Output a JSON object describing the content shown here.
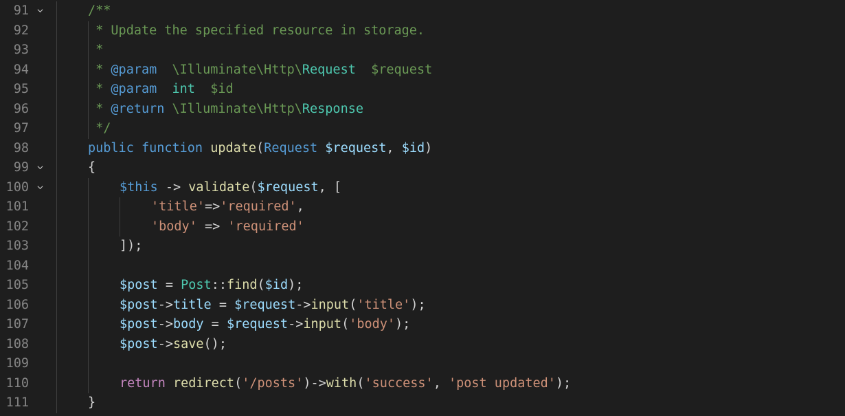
{
  "editor": {
    "lines": [
      {
        "number": "91",
        "fold": true,
        "indent": 1,
        "tokens": [
          {
            "t": "/**",
            "c": "c-com"
          }
        ]
      },
      {
        "number": "92",
        "fold": false,
        "indent": 1,
        "tokens": [
          {
            "t": " * Update the specified resource in storage.",
            "c": "c-com"
          }
        ]
      },
      {
        "number": "93",
        "fold": false,
        "indent": 1,
        "tokens": [
          {
            "t": " *",
            "c": "c-com"
          }
        ]
      },
      {
        "number": "94",
        "fold": false,
        "indent": 1,
        "tokens": [
          {
            "t": " * ",
            "c": "c-com"
          },
          {
            "t": "@param",
            "c": "c-tag"
          },
          {
            "t": "  \\Illuminate\\Http\\",
            "c": "c-com"
          },
          {
            "t": "Request",
            "c": "c-cls"
          },
          {
            "t": "  $request",
            "c": "c-com"
          }
        ]
      },
      {
        "number": "95",
        "fold": false,
        "indent": 1,
        "tokens": [
          {
            "t": " * ",
            "c": "c-com"
          },
          {
            "t": "@param",
            "c": "c-tag"
          },
          {
            "t": "  ",
            "c": "c-com"
          },
          {
            "t": "int",
            "c": "c-cls"
          },
          {
            "t": "  $id",
            "c": "c-com"
          }
        ]
      },
      {
        "number": "96",
        "fold": false,
        "indent": 1,
        "tokens": [
          {
            "t": " * ",
            "c": "c-com"
          },
          {
            "t": "@return",
            "c": "c-tag"
          },
          {
            "t": " \\Illuminate\\Http\\",
            "c": "c-com"
          },
          {
            "t": "Response",
            "c": "c-cls"
          }
        ]
      },
      {
        "number": "97",
        "fold": false,
        "indent": 1,
        "tokens": [
          {
            "t": " */",
            "c": "c-com"
          }
        ]
      },
      {
        "number": "98",
        "fold": false,
        "indent": 1,
        "tokens": [
          {
            "t": "public",
            "c": "c-kw"
          },
          {
            "t": " ",
            "c": "c-pun"
          },
          {
            "t": "function",
            "c": "c-kw"
          },
          {
            "t": " ",
            "c": "c-pun"
          },
          {
            "t": "update",
            "c": "c-fn"
          },
          {
            "t": "(",
            "c": "c-pun"
          },
          {
            "t": "Request",
            "c": "c-kw"
          },
          {
            "t": " ",
            "c": "c-pun"
          },
          {
            "t": "$request",
            "c": "c-var"
          },
          {
            "t": ", ",
            "c": "c-pun"
          },
          {
            "t": "$id",
            "c": "c-var"
          },
          {
            "t": ")",
            "c": "c-pun"
          }
        ]
      },
      {
        "number": "99",
        "fold": true,
        "indent": 1,
        "tokens": [
          {
            "t": "{",
            "c": "c-pun"
          }
        ]
      },
      {
        "number": "100",
        "fold": true,
        "indent": 2,
        "tokens": [
          {
            "t": "$this",
            "c": "c-this"
          },
          {
            "t": " -> ",
            "c": "c-pun"
          },
          {
            "t": "validate",
            "c": "c-fn"
          },
          {
            "t": "(",
            "c": "c-pun"
          },
          {
            "t": "$request",
            "c": "c-var"
          },
          {
            "t": ", [",
            "c": "c-pun"
          }
        ]
      },
      {
        "number": "101",
        "fold": false,
        "indent": 3,
        "tokens": [
          {
            "t": "'title'",
            "c": "c-str"
          },
          {
            "t": "=>",
            "c": "c-pun"
          },
          {
            "t": "'required'",
            "c": "c-str"
          },
          {
            "t": ",",
            "c": "c-pun"
          }
        ]
      },
      {
        "number": "102",
        "fold": false,
        "indent": 3,
        "tokens": [
          {
            "t": "'body'",
            "c": "c-str"
          },
          {
            "t": " => ",
            "c": "c-pun"
          },
          {
            "t": "'required'",
            "c": "c-str"
          }
        ]
      },
      {
        "number": "103",
        "fold": false,
        "indent": 2,
        "tokens": [
          {
            "t": "]);",
            "c": "c-pun"
          }
        ]
      },
      {
        "number": "104",
        "fold": false,
        "indent": 2,
        "tokens": []
      },
      {
        "number": "105",
        "fold": false,
        "indent": 2,
        "tokens": [
          {
            "t": "$post",
            "c": "c-var"
          },
          {
            "t": " = ",
            "c": "c-pun"
          },
          {
            "t": "Post",
            "c": "c-cls"
          },
          {
            "t": "::",
            "c": "c-pun"
          },
          {
            "t": "find",
            "c": "c-fn"
          },
          {
            "t": "(",
            "c": "c-pun"
          },
          {
            "t": "$id",
            "c": "c-var"
          },
          {
            "t": ");",
            "c": "c-pun"
          }
        ]
      },
      {
        "number": "106",
        "fold": false,
        "indent": 2,
        "tokens": [
          {
            "t": "$post",
            "c": "c-var"
          },
          {
            "t": "->",
            "c": "c-pun"
          },
          {
            "t": "title",
            "c": "c-var"
          },
          {
            "t": " = ",
            "c": "c-pun"
          },
          {
            "t": "$request",
            "c": "c-var"
          },
          {
            "t": "->",
            "c": "c-pun"
          },
          {
            "t": "input",
            "c": "c-fn"
          },
          {
            "t": "(",
            "c": "c-pun"
          },
          {
            "t": "'title'",
            "c": "c-str"
          },
          {
            "t": ");",
            "c": "c-pun"
          }
        ]
      },
      {
        "number": "107",
        "fold": false,
        "indent": 2,
        "tokens": [
          {
            "t": "$post",
            "c": "c-var"
          },
          {
            "t": "->",
            "c": "c-pun"
          },
          {
            "t": "body",
            "c": "c-var"
          },
          {
            "t": " = ",
            "c": "c-pun"
          },
          {
            "t": "$request",
            "c": "c-var"
          },
          {
            "t": "->",
            "c": "c-pun"
          },
          {
            "t": "input",
            "c": "c-fn"
          },
          {
            "t": "(",
            "c": "c-pun"
          },
          {
            "t": "'body'",
            "c": "c-str"
          },
          {
            "t": ");",
            "c": "c-pun"
          }
        ]
      },
      {
        "number": "108",
        "fold": false,
        "indent": 2,
        "tokens": [
          {
            "t": "$post",
            "c": "c-var"
          },
          {
            "t": "->",
            "c": "c-pun"
          },
          {
            "t": "save",
            "c": "c-fn"
          },
          {
            "t": "();",
            "c": "c-pun"
          }
        ]
      },
      {
        "number": "109",
        "fold": false,
        "indent": 2,
        "tokens": []
      },
      {
        "number": "110",
        "fold": false,
        "indent": 2,
        "tokens": [
          {
            "t": "return",
            "c": "c-ctl"
          },
          {
            "t": " ",
            "c": "c-pun"
          },
          {
            "t": "redirect",
            "c": "c-fn"
          },
          {
            "t": "(",
            "c": "c-pun"
          },
          {
            "t": "'/posts'",
            "c": "c-str"
          },
          {
            "t": ")->",
            "c": "c-pun"
          },
          {
            "t": "with",
            "c": "c-fn"
          },
          {
            "t": "(",
            "c": "c-pun"
          },
          {
            "t": "'success'",
            "c": "c-str"
          },
          {
            "t": ", ",
            "c": "c-pun"
          },
          {
            "t": "'post updated'",
            "c": "c-str"
          },
          {
            "t": ");",
            "c": "c-pun"
          }
        ]
      },
      {
        "number": "111",
        "fold": false,
        "indent": 1,
        "tokens": [
          {
            "t": "}",
            "c": "c-pun"
          }
        ]
      }
    ]
  }
}
